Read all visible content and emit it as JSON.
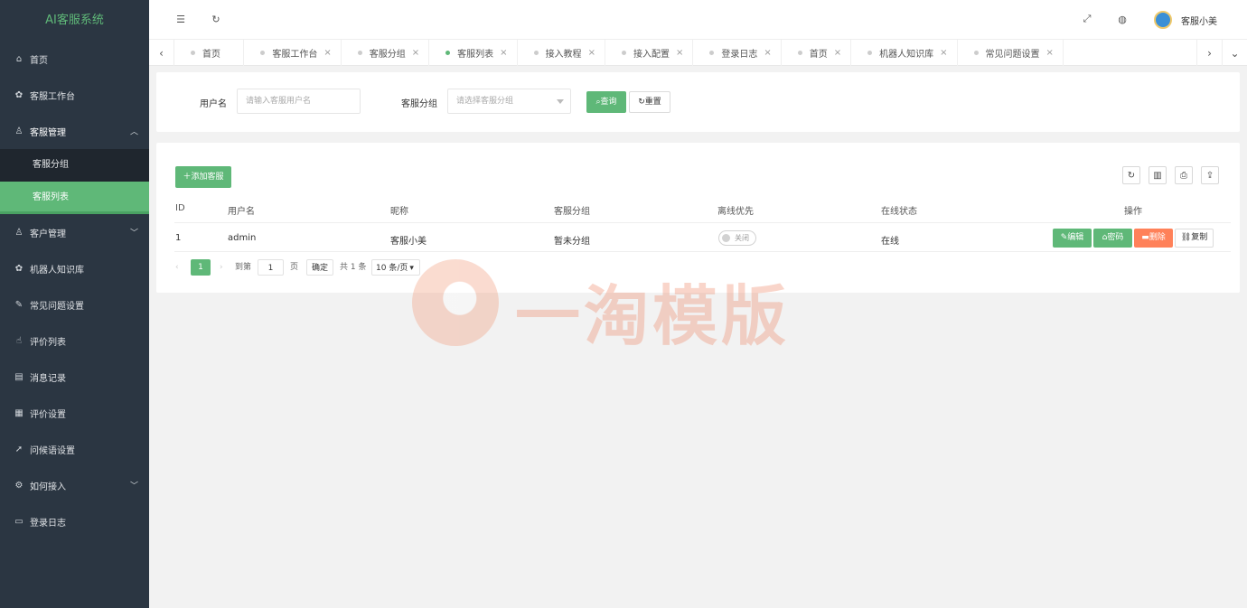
{
  "app": {
    "title": "AI客服系统"
  },
  "sidebar": {
    "items": [
      {
        "label": "首页",
        "icon": "home-icon"
      },
      {
        "label": "客服工作台",
        "icon": "gear-icon"
      },
      {
        "label": "客服管理",
        "icon": "user-icon",
        "open": true,
        "children": [
          {
            "label": "客服分组"
          },
          {
            "label": "客服列表",
            "active": true
          }
        ]
      },
      {
        "label": "客户管理",
        "icon": "users-icon"
      },
      {
        "label": "机器人知识库",
        "icon": "gear-icon"
      },
      {
        "label": "常见问题设置",
        "icon": "edit-icon"
      },
      {
        "label": "评价列表",
        "icon": "thumb-icon"
      },
      {
        "label": "消息记录",
        "icon": "doc-icon"
      },
      {
        "label": "评价设置",
        "icon": "calendar-icon"
      },
      {
        "label": "问候语设置",
        "icon": "send-icon"
      },
      {
        "label": "如何接入",
        "icon": "cog-icon"
      },
      {
        "label": "登录日志",
        "icon": "log-icon"
      }
    ]
  },
  "header": {
    "user_name": "客服小美"
  },
  "tabs": [
    {
      "label": "首页"
    },
    {
      "label": "客服工作台"
    },
    {
      "label": "客服分组"
    },
    {
      "label": "客服列表",
      "active": true
    },
    {
      "label": "接入教程"
    },
    {
      "label": "接入配置"
    },
    {
      "label": "登录日志"
    },
    {
      "label": "首页"
    },
    {
      "label": "机器人知识库"
    },
    {
      "label": "常见问题设置"
    }
  ],
  "search": {
    "username_label": "用户名",
    "username_placeholder": "请输入客服用户名",
    "group_label": "客服分组",
    "group_placeholder": "请选择客服分组",
    "query_label": "查询",
    "reset_label": "重置"
  },
  "table": {
    "add_label": "添加客服",
    "columns": [
      "ID",
      "用户名",
      "昵称",
      "客服分组",
      "离线优先",
      "在线状态",
      "操作"
    ],
    "rows": [
      {
        "id": "1",
        "username": "admin",
        "nickname": "客服小美",
        "group": "暂未分组",
        "offline_first": "关闭",
        "status": "在线"
      }
    ],
    "actions": {
      "edit": "编辑",
      "password": "密码",
      "delete": "删除",
      "copy": "复制"
    }
  },
  "pagination": {
    "current": "1",
    "goto_label": "到第",
    "page_value": "1",
    "page_unit": "页",
    "confirm": "确定",
    "total": "共 1 条",
    "page_size": "10 条/页"
  },
  "watermark": {
    "text": "一淘模版"
  },
  "colors": {
    "accent": "#5fb878",
    "sidebar_bg": "#2b3642",
    "danger": "#ff5722"
  }
}
